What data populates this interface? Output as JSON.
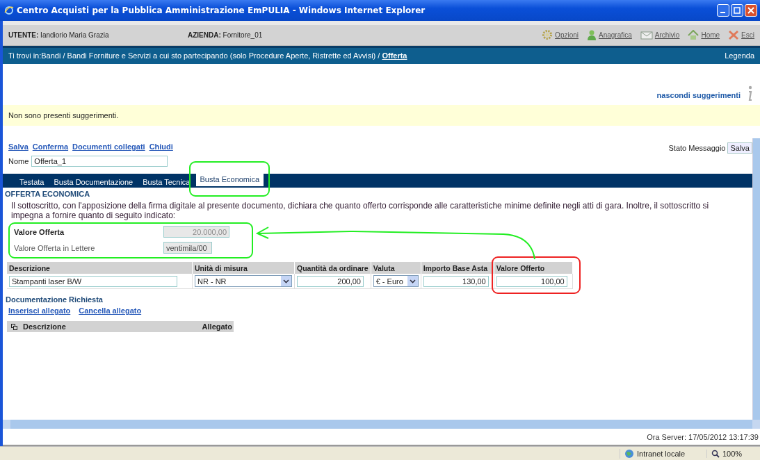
{
  "window": {
    "title": "Centro Acquisti per la Pubblica Amministrazione EmPULIA - Windows Internet Explorer"
  },
  "user_bar": {
    "user_label": "UTENTE:",
    "user": "Iandiorio Maria Grazia",
    "company_label": "AZIENDA:",
    "company": "Fornitore_01",
    "links": [
      {
        "label": "Opzioni",
        "kind": "gear"
      },
      {
        "label": "Anagrafica",
        "kind": "person"
      },
      {
        "label": "Archivio",
        "kind": "envelope"
      },
      {
        "label": "Home",
        "kind": "house"
      },
      {
        "label": "Esci",
        "kind": "exit"
      }
    ]
  },
  "breadcrumb": {
    "path": "Ti trovi in:Bandi / Bandi Forniture e Servizi a cui sto partecipando (solo Procedure Aperte, Ristrette ed Avvisi) /",
    "current": "Offerta",
    "legend": "Legenda"
  },
  "suggestions": {
    "toggle": "nascondi suggerimenti",
    "message": "Non sono presenti suggerimenti."
  },
  "toolbar": [
    "Salva",
    "Conferma",
    "Documenti collegati",
    "Chiudi"
  ],
  "name_field": {
    "label": "Nome",
    "value": "Offerta_1"
  },
  "message_status": {
    "label": "Stato Messaggio",
    "value": "Salva"
  },
  "tabs": [
    {
      "label": "Testata",
      "selected": false
    },
    {
      "label": "Busta Documentazione",
      "selected": false
    },
    {
      "label": "Busta Tecnica",
      "selected": false
    },
    {
      "label": "Busta Economica",
      "selected": true
    }
  ],
  "section_title": "OFFERTA ECONOMICA",
  "declaration": "Il sottoscritto, con l'apposizione della firma digitale al presente documento, dichiara che quanto offerto corrisponde alle caratteristiche minime definite negli atti di gara. Inoltre, il sottoscritto si impegna a fornire quanto di seguito indicato:",
  "offer_summary": [
    {
      "label": "Valore Offerta",
      "value": "20.000,00",
      "kind": "amount"
    },
    {
      "label": "Valore Offerta in Lettere",
      "value": "ventimila/00",
      "kind": "words"
    }
  ],
  "table": {
    "columns": [
      "Descrizione",
      "Unità di misura",
      "Quantità da ordinare",
      "Valuta",
      "Importo Base Asta",
      "Valore Offerto"
    ],
    "rows": [
      {
        "cells": [
          {
            "kind": "text",
            "value": "Stampanti laser B/W"
          },
          {
            "kind": "select",
            "value": "NR - NR"
          },
          {
            "kind": "number",
            "value": "200,00"
          },
          {
            "kind": "select",
            "value": "€ - Euro"
          },
          {
            "kind": "number",
            "value": "130,00"
          },
          {
            "kind": "number",
            "value": "100,00"
          }
        ]
      }
    ]
  },
  "documents": {
    "title": "Documentazione Richiesta",
    "links": [
      "Inserisci allegato",
      "Cancella allegato"
    ],
    "columns": [
      "Descrizione",
      "Allegato"
    ]
  },
  "server_time": "Ora Server: 17/05/2012 13:17:39",
  "status_bar": {
    "zone": "Intranet locale",
    "zoom": "100%"
  }
}
